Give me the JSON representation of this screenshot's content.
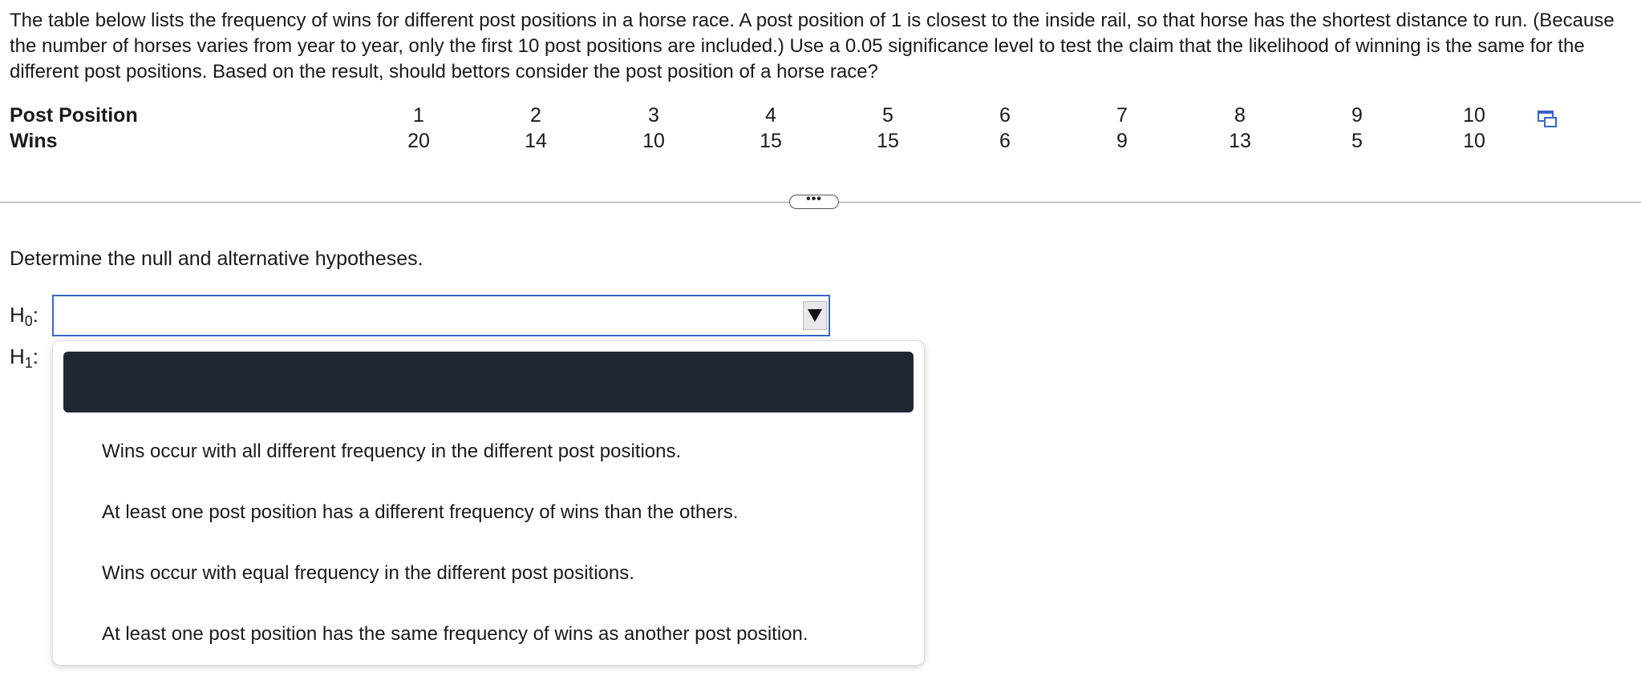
{
  "question": {
    "text": "The table below lists the frequency of wins for different post positions in a horse race. A post position of 1 is closest to the inside rail, so that horse has the shortest distance to run. (Because the number of horses varies from year to year, only the first 10 post positions are included.) Use a 0.05 significance level to test the claim that the likelihood of winning is the same for the different post positions. Based on the result, should bettors consider the post position of a horse race?"
  },
  "table": {
    "row1_label": "Post Position",
    "row2_label": "Wins",
    "positions": [
      "1",
      "2",
      "3",
      "4",
      "5",
      "6",
      "7",
      "8",
      "9",
      "10"
    ],
    "wins": [
      "20",
      "14",
      "10",
      "15",
      "15",
      "6",
      "9",
      "13",
      "5",
      "10"
    ]
  },
  "icons": {
    "copy": "copy-data-icon",
    "expand": "ellipsis-icon",
    "dropdown_arrow": "triangle-down-icon"
  },
  "more_button": {
    "label": "•••"
  },
  "prompt": "Determine the null and alternative hypotheses.",
  "hypotheses": {
    "h0_prefix": "H",
    "h0_sub": "0",
    "h1_prefix": "H",
    "h1_sub": "1",
    "colon": ":",
    "h0_value": ""
  },
  "dropdown": {
    "highlighted_option": "",
    "options": [
      "Wins occur with all different frequency in the different post positions.",
      "At least one post position has a different frequency of wins than the others.",
      "Wins occur with equal frequency in the different post positions.",
      "At least one post position has the same frequency of wins as another post position."
    ]
  },
  "colors": {
    "accent": "#3a63c9",
    "highlight": "#1f2733",
    "divider": "#9a9a9a"
  }
}
